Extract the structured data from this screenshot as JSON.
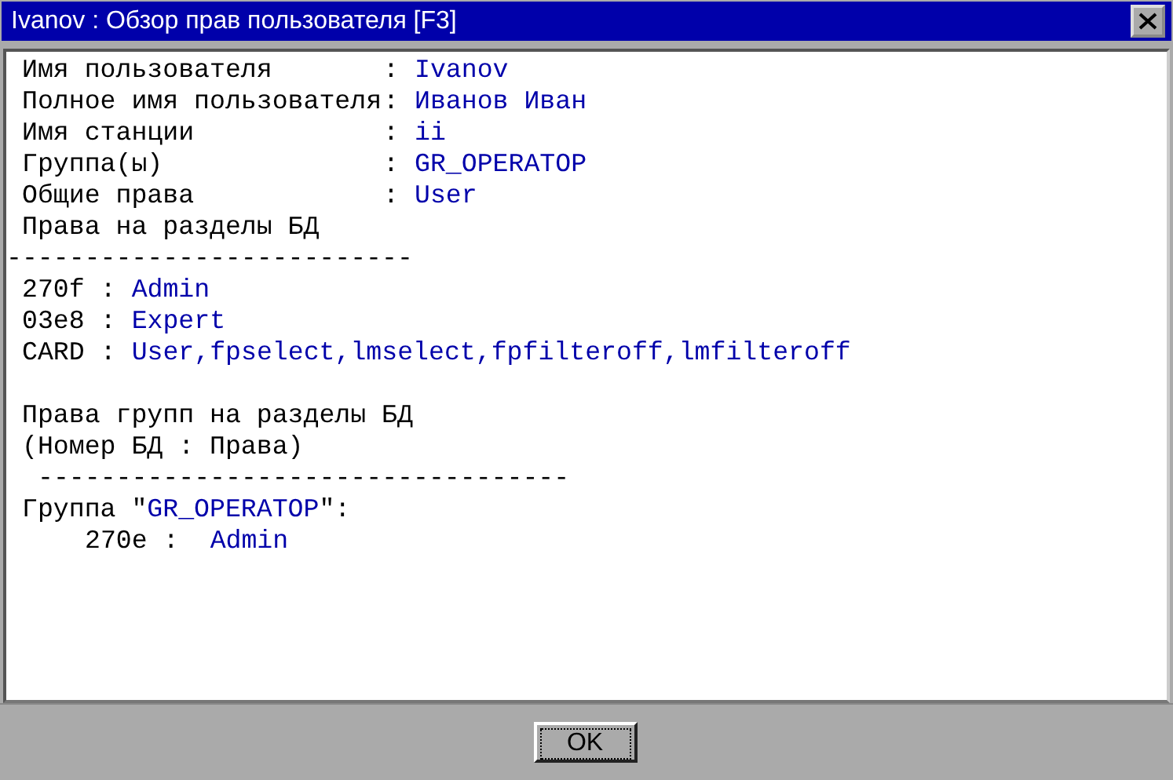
{
  "window": {
    "title": "Ivanov : Обзор прав пользователя [F3]"
  },
  "fields": [
    {
      "label": "Имя пользователя",
      "sep": ":",
      "value": "Ivanov"
    },
    {
      "label": "Полное имя пользователя",
      "sep": ":",
      "value": "Иванов Иван"
    },
    {
      "label": "Имя станции",
      "sep": ":",
      "value": "ii"
    },
    {
      "label": "Группа(ы)",
      "sep": ":",
      "value": "GR_OPERATOP"
    },
    {
      "label": "Общие права",
      "sep": ":",
      "value": "User"
    }
  ],
  "db_rights": {
    "heading": "Права на разделы БД",
    "rule": "--------------------------",
    "rows": [
      {
        "code": "270f",
        "sep": ":",
        "value": "Admin"
      },
      {
        "code": "03e8",
        "sep": ":",
        "value": "Expert"
      },
      {
        "code": "CARD",
        "sep": ":",
        "value": "User,fpselect,lmselect,fpfilteroff,lmfilteroff"
      }
    ]
  },
  "group_rights": {
    "heading": "Права групп на разделы БД",
    "subheading": "(Номер БД : Права)",
    "rule": "----------------------------------",
    "groups": [
      {
        "prefix": "Группа \"",
        "name": "GR_OPERATOP",
        "suffix": "\":",
        "rows": [
          {
            "code": "270e",
            "sep": ":",
            "value": "Admin"
          }
        ]
      }
    ]
  },
  "buttons": [
    "OK"
  ]
}
